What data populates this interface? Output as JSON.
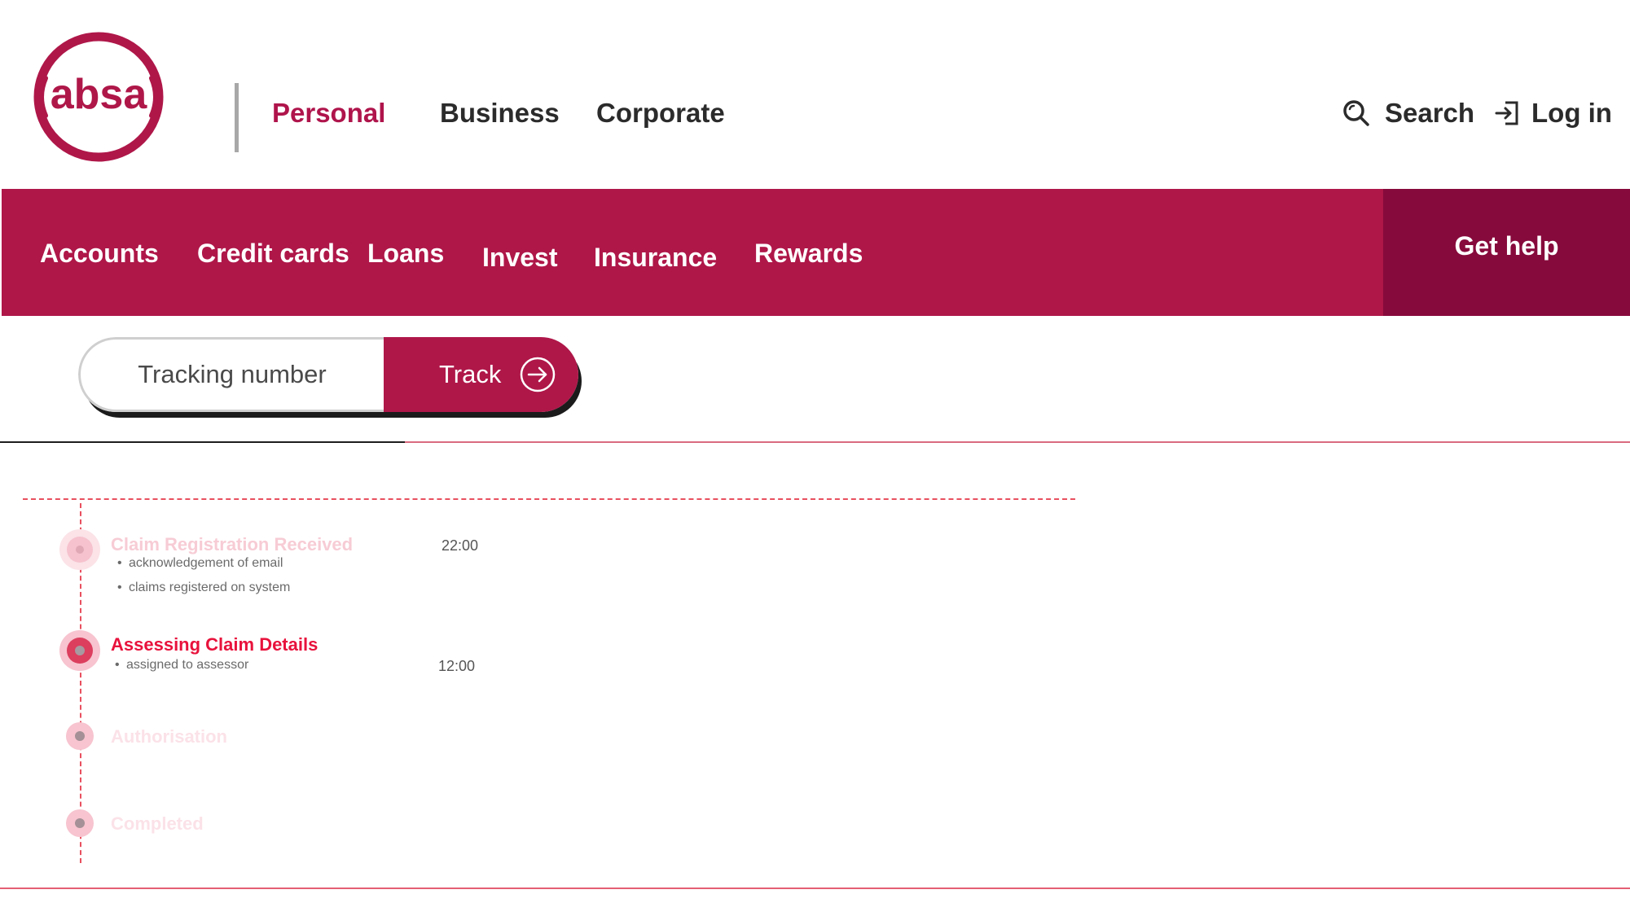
{
  "brand": {
    "logo_text": "absa",
    "color": "#af1749"
  },
  "top_nav": {
    "items": [
      "Personal",
      "Business",
      "Corporate"
    ],
    "active": "Personal",
    "search_label": "Search",
    "login_label": "Log in"
  },
  "main_nav": {
    "items": [
      "Accounts",
      "Credit cards",
      "Loans",
      "Invest",
      "Insurance",
      "Rewards"
    ],
    "get_help_label": "Get help",
    "bar_color": "#af1749",
    "help_color": "#870a3c"
  },
  "tracker": {
    "placeholder": "Tracking number",
    "button_label": "Track"
  },
  "timeline": {
    "steps": [
      {
        "title": "Claim Registration Received",
        "status": "completed",
        "time": "22:00",
        "details": [
          "acknowledgement of email",
          "claims registered on system"
        ]
      },
      {
        "title": "Assessing Claim Details",
        "status": "active",
        "time": "12:00",
        "details": [
          "assigned to assessor"
        ]
      },
      {
        "title": "Authorisation",
        "status": "pending",
        "time": "",
        "details": []
      },
      {
        "title": "Completed",
        "status": "pending",
        "time": "",
        "details": []
      }
    ],
    "accent_color": "#e8123c"
  }
}
